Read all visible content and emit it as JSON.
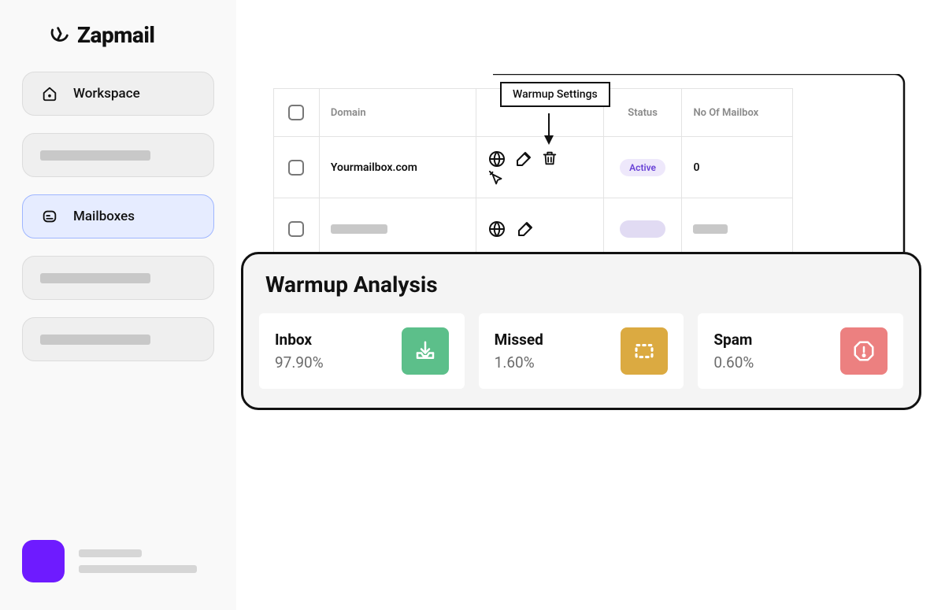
{
  "brand": {
    "name": "Zapmail"
  },
  "sidebar": {
    "workspace_label": "Workspace",
    "mailboxes_label": "Mailboxes"
  },
  "table": {
    "headers": {
      "domain": "Domain",
      "status": "Status",
      "count": "No Of Mailbox"
    },
    "tooltip": "Warmup Settings",
    "rows": [
      {
        "domain": "Yourmailbox.com",
        "status": "Active",
        "count": "0"
      }
    ]
  },
  "panel": {
    "title": "Warmup Analysis",
    "metrics": {
      "inbox": {
        "label": "Inbox",
        "value": "97.90%"
      },
      "missed": {
        "label": "Missed",
        "value": "1.60%"
      },
      "spam": {
        "label": "Spam",
        "value": "0.60%"
      }
    }
  },
  "colors": {
    "accent": "#6e1bff",
    "inbox": "#5cbf8a",
    "missed": "#dbaa41",
    "spam": "#ec8080"
  }
}
